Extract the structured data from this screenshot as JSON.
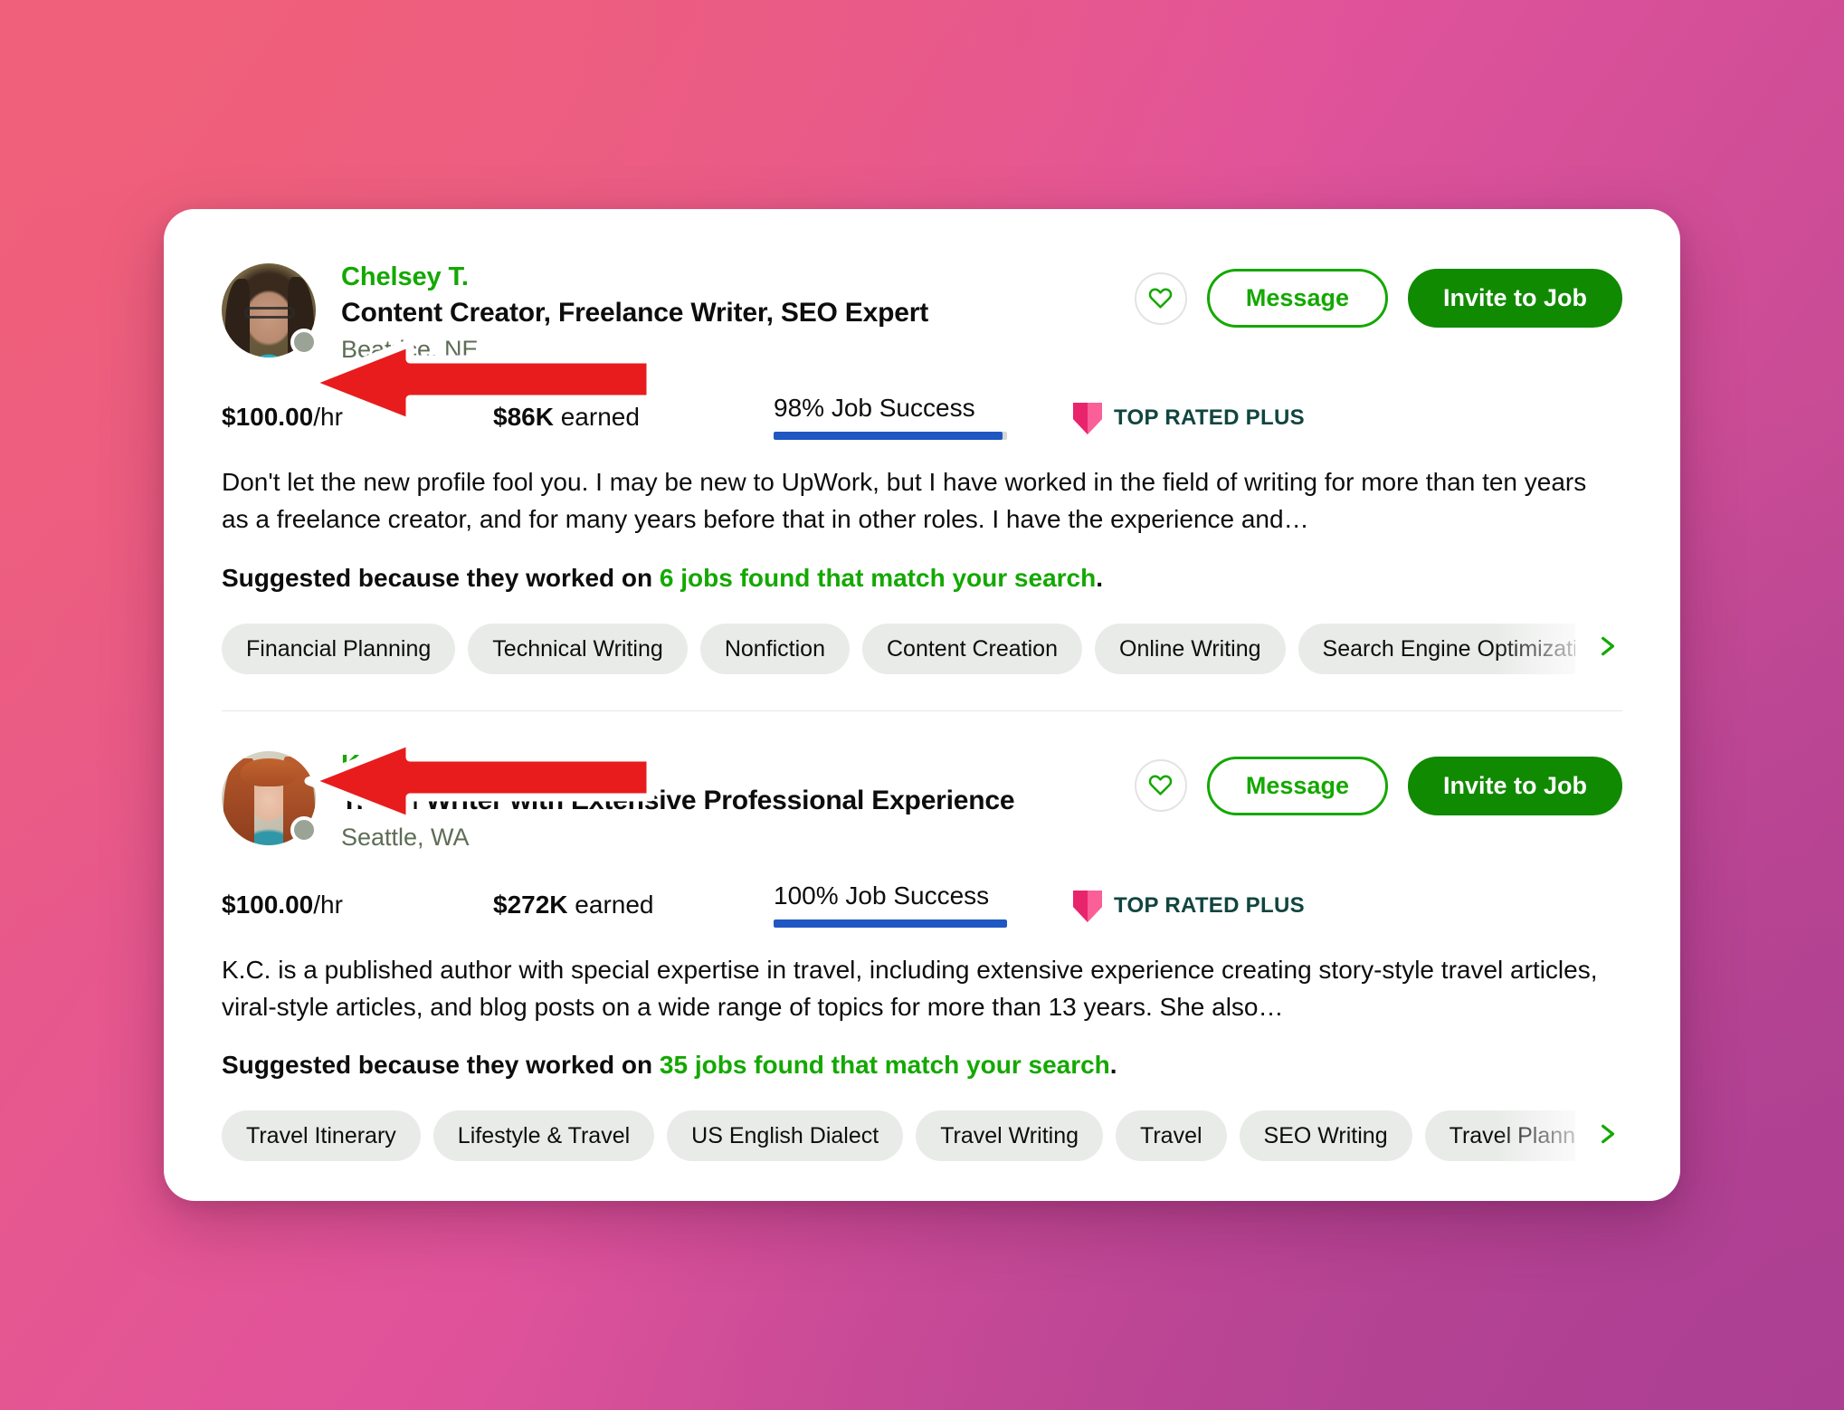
{
  "theme": {
    "accent_green": "#14a800",
    "invite_green": "#108a00",
    "jss_blue": "#1f57c3",
    "badge_pink": "#f0407c",
    "badge_text": "#11453f",
    "tag_bg": "#e9ebe9",
    "arrow_red": "#e81c1c"
  },
  "freelancers": [
    {
      "name": "Chelsey T.",
      "title": "Content Creator, Freelance Writer, SEO Expert",
      "location": "Beatrice, NE",
      "avatar_name": "chelsey",
      "status": "away",
      "actions": {
        "favorite_icon": "heart-icon",
        "message_label": "Message",
        "invite_label": "Invite to Job"
      },
      "stats": {
        "rate_amount": "$100.00",
        "rate_unit": "/hr",
        "earned_amount": "$86K",
        "earned_label": "earned",
        "job_success": "98% Job Success",
        "job_success_pct": 98,
        "badge_label": "TOP RATED PLUS",
        "badge_icon": "shield-icon"
      },
      "description": "Don't let the new profile fool you. I may be new to UpWork, but I have worked in the field of writing for more than ten years as a freelance creator, and for many years before that in other roles. I have the experience and…",
      "suggested_prefix": "Suggested because they worked on ",
      "suggested_link": "6 jobs found that match your search",
      "suggested_suffix": ".",
      "tags": [
        "Financial Planning",
        "Technical Writing",
        "Nonfiction",
        "Content Creation",
        "Online Writing",
        "Search Engine Optimization"
      ],
      "tags_next_icon": "chevron-right-icon"
    },
    {
      "name": "Karen 'K.C.' D.",
      "title": "Travel Writer with Extensive Professional Experience",
      "location": "Seattle, WA",
      "avatar_name": "karen",
      "status": "away",
      "actions": {
        "favorite_icon": "heart-icon",
        "message_label": "Message",
        "invite_label": "Invite to Job"
      },
      "stats": {
        "rate_amount": "$100.00",
        "rate_unit": "/hr",
        "earned_amount": "$272K",
        "earned_label": "earned",
        "job_success": "100% Job Success",
        "job_success_pct": 100,
        "badge_label": "TOP RATED PLUS",
        "badge_icon": "shield-icon"
      },
      "description": "K.C. is a published author with special expertise in travel, including extensive experience creating story-style travel articles, viral-style articles, and blog posts on a wide range of topics for more than 13 years. She also…",
      "suggested_prefix": "Suggested because they worked on ",
      "suggested_link": "35 jobs found that match your search",
      "suggested_suffix": ".",
      "tags": [
        "Travel Itinerary",
        "Lifestyle & Travel",
        "US English Dialect",
        "Travel Writing",
        "Travel",
        "SEO Writing",
        "Travel Planning"
      ],
      "tags_next_icon": "chevron-right-icon"
    }
  ],
  "annotations": [
    {
      "name": "arrow-pointing-to-rate-1",
      "icon": "left-arrow-annotation"
    },
    {
      "name": "arrow-pointing-to-rate-2",
      "icon": "left-arrow-annotation"
    }
  ]
}
